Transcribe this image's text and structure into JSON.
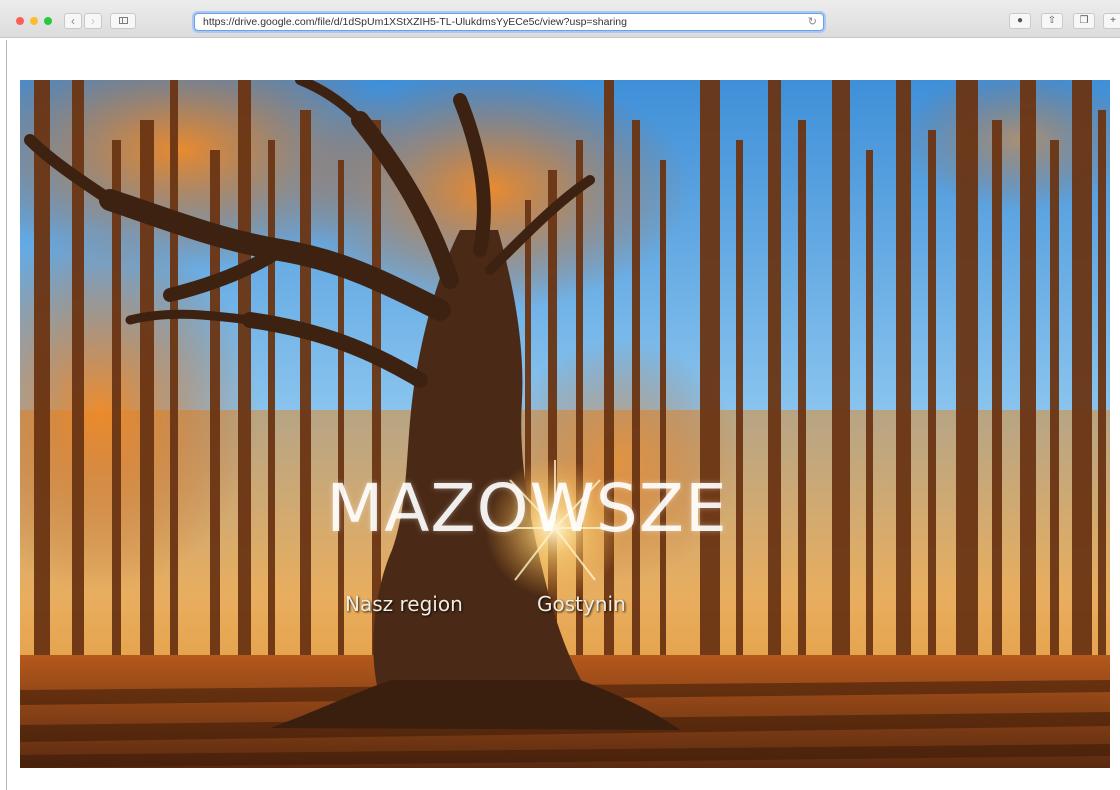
{
  "browser": {
    "url": "https://drive.google.com/file/d/1dSpUm1XStXZIH5-TL-UlukdmsYyECe5c/view?usp=sharing",
    "icons": [
      "close-window",
      "minimize-window",
      "zoom-window",
      "back-arrow",
      "forward-arrow",
      "sidebar-toggle",
      "reload",
      "info",
      "share",
      "tabs-overview",
      "more"
    ]
  },
  "hero": {
    "title": "MAZOWSZE",
    "subtitle_region": "Nasz region",
    "subtitle_city": "Gostynin"
  },
  "colors": {
    "sky": "#5aa7e6",
    "foliage": "#e8771d",
    "trunk": "#6b3a1a",
    "ground": "#8a3f12"
  }
}
